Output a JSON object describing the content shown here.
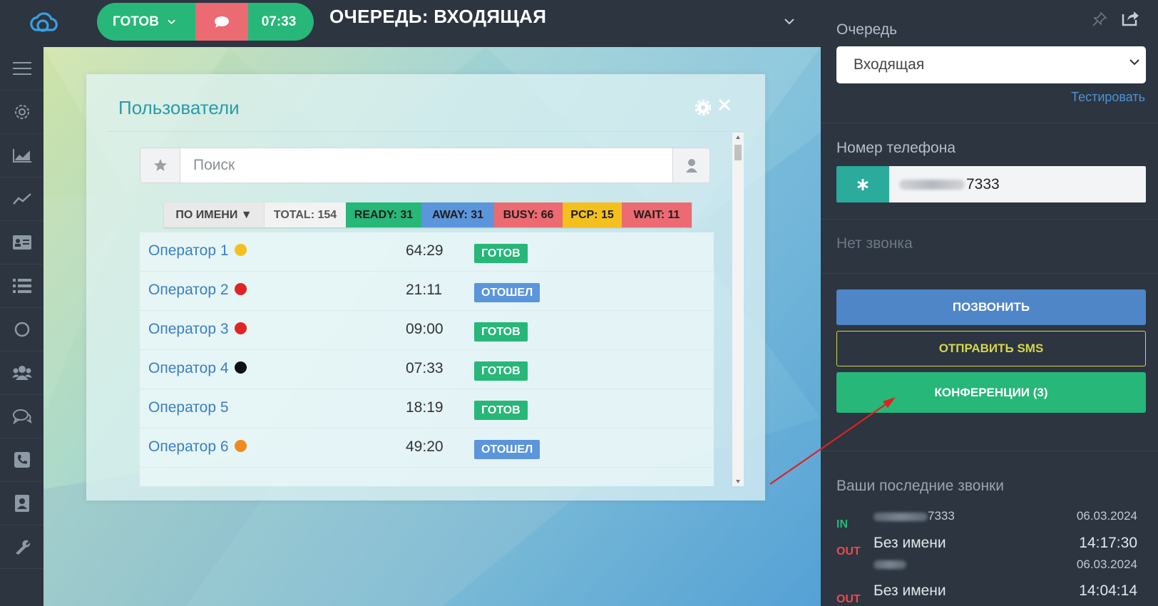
{
  "topbar": {
    "status_label": "ГОТОВ",
    "timer": "07:33",
    "queue_title": "ОЧЕРЕДЬ: ВХОДЯЩАЯ"
  },
  "leftnav": {
    "items": [
      "menu-icon",
      "gear-icon",
      "area-chart-icon",
      "line-chart-icon",
      "id-card-icon",
      "list-icon",
      "circle-icon",
      "users-icon",
      "chat-icon",
      "phone-icon",
      "contacts-icon",
      "wrench-icon"
    ]
  },
  "panel": {
    "title": "Пользователи",
    "search_placeholder": "Поиск",
    "filters": {
      "by_name": "ПО ИМЕНИ ▼",
      "total": "TOTAL: 154",
      "ready": "READY: 31",
      "away": "AWAY: 31",
      "busy": "BUSY: 66",
      "pcp": "PCP: 15",
      "wait": "WAIT: 11"
    },
    "operators": [
      {
        "name": "Оператор 1",
        "dot": "#f4c01e",
        "time": "64:29",
        "status": "ГОТОВ",
        "status_color": "#27b778"
      },
      {
        "name": "Оператор 2",
        "dot": "#e02424",
        "time": "21:11",
        "status": "ОТОШЕЛ",
        "status_color": "#5b95db"
      },
      {
        "name": "Оператор 3",
        "dot": "#e02424",
        "time": "09:00",
        "status": "ГОТОВ",
        "status_color": "#27b778"
      },
      {
        "name": "Оператор 4",
        "dot": "#111111",
        "time": "07:33",
        "status": "ГОТОВ",
        "status_color": "#27b778"
      },
      {
        "name": "Оператор 5",
        "dot": null,
        "time": "18:19",
        "status": "ГОТОВ",
        "status_color": "#27b778"
      },
      {
        "name": "Оператор 6",
        "dot": "#f08a1e",
        "time": "49:20",
        "status": "ОТОШЕЛ",
        "status_color": "#5b95db"
      }
    ]
  },
  "right": {
    "queue_label": "Очередь",
    "queue_value": "Входящая",
    "test_link": "Тестировать",
    "phone_label": "Номер телефона",
    "phone_suffix": "7333",
    "no_call": "Нет звонка",
    "call_button": "ПОЗВОНИТЬ",
    "sms_button": "ОТПРАВИТЬ SMS",
    "conf_button": "КОНФЕРЕНЦИИ (3)",
    "recent_title": "Ваши последние звонки",
    "calls": [
      {
        "dir": "IN",
        "dir_color": "#27b778",
        "number_suffix": "7333",
        "date": "06.03.2024"
      },
      {
        "dir": "OUT",
        "dir_color": "#ec4a52",
        "name": "Без имени",
        "time": "14:17:30",
        "date": "06.03.2024"
      },
      {
        "dir": "OUT",
        "dir_color": "#ec4a52",
        "name": "Без имени",
        "time": "14:04:14"
      }
    ]
  },
  "colors": {
    "accent_green": "#27b778",
    "accent_red": "#ec6a72",
    "accent_blue": "#4e86c7",
    "sidebar_bg": "#2c3540"
  }
}
